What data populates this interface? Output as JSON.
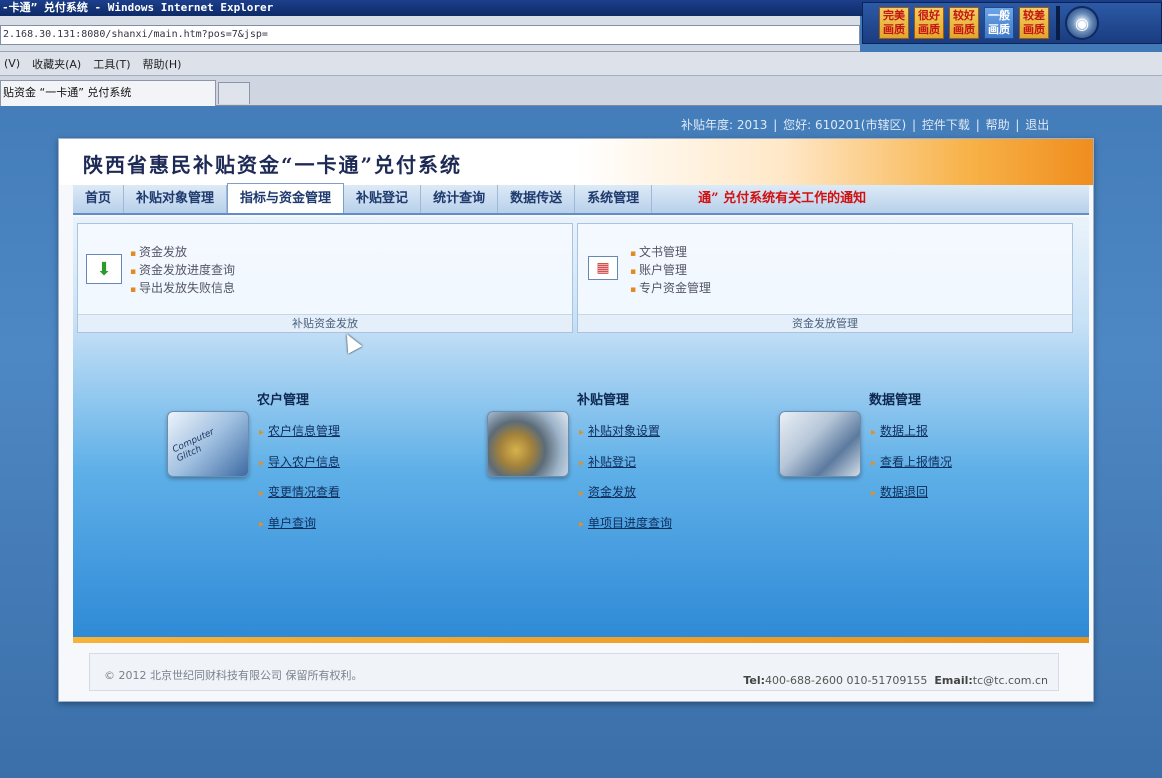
{
  "browser": {
    "window_title": "-卡通” 兑付系统 - Windows Internet Explorer",
    "address": "2.168.30.131:8080/shanxi/main.htm?pos=7&jsp=",
    "menu": [
      "(V)",
      "收藏夹(A)",
      "工具(T)",
      "帮助(H)"
    ],
    "tab_title": "贴资金 “一卡通” 兑付系统",
    "quality_buttons": [
      "完美\n画质",
      "很好\n画质",
      "较好\n画质",
      "一般\n画质",
      "较差\n画质"
    ],
    "quality_icon": "settings-disc-icon"
  },
  "toplinks": {
    "year_label": "补贴年度: 2013",
    "greeting": "您好: 610201(市辖区)",
    "download": "控件下载",
    "help": "帮助",
    "logout": "退出",
    "sep": "|"
  },
  "app": {
    "title": "陕西省惠民补贴资金“一卡通”兑付系统",
    "nav": [
      "首页",
      "补贴对象管理",
      "指标与资金管理",
      "补贴登记",
      "统计查询",
      "数据传送",
      "系统管理"
    ],
    "active_nav": "指标与资金管理",
    "notice": "通” 兑付系统有关工作的通知"
  },
  "panels": {
    "left": {
      "links": [
        "资金发放",
        "资金发放进度查询",
        "导出发放失败信息"
      ],
      "caption": "补贴资金发放",
      "icon": "download-arrow-icon"
    },
    "right": {
      "links": [
        "文书管理",
        "账户管理",
        "专户资金管理"
      ],
      "caption": "资金发放管理",
      "icon": "calendar-icon"
    }
  },
  "modules": [
    {
      "title": "农户管理",
      "image_text": "Computer Glitch",
      "links": [
        "农户信息管理",
        "导入农户信息",
        "变更情况查看",
        "单户查询"
      ]
    },
    {
      "title": "补贴管理",
      "links": [
        "补贴对象设置",
        "补贴登记",
        "资金发放",
        "单项目进度查询"
      ]
    },
    {
      "title": "数据管理",
      "links": [
        "数据上报",
        "查看上报情况",
        "数据退回"
      ]
    }
  ],
  "footer": {
    "copyright": "© 2012 北京世纪同财科技有限公司 保留所有权利。",
    "tel_label": "Tel:",
    "tel": "400-688-2600  010-51709155",
    "email_label": "Email:",
    "email": "tc@tc.com.cn"
  }
}
